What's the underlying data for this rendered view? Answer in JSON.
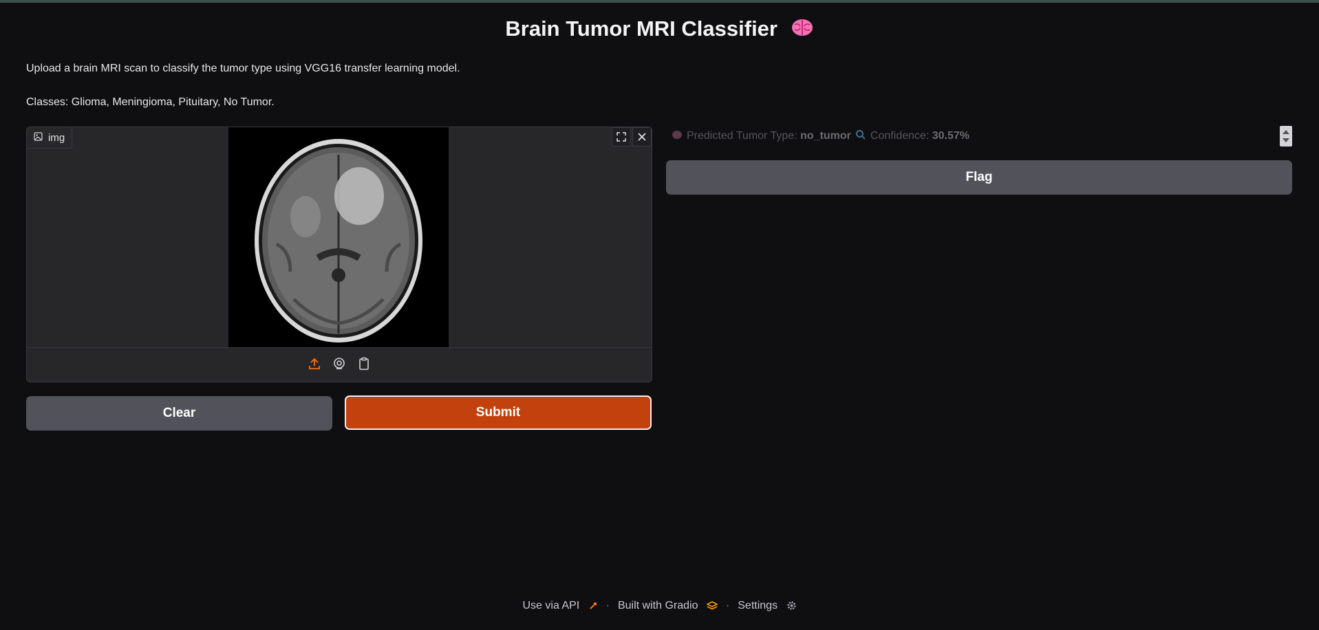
{
  "header": {
    "title": "Brain Tumor MRI Classifier",
    "title_icon": "brain-icon"
  },
  "description": {
    "line1": "Upload a brain MRI scan to classify the tumor type using VGG16 transfer learning model.",
    "line2": "Classes: Glioma, Meningioma, Pituitary, No Tumor."
  },
  "image_input": {
    "label": "img",
    "label_icon": "image-icon",
    "tools": [
      "fullscreen-icon",
      "close-icon"
    ],
    "sources": [
      "upload-icon",
      "webcam-icon",
      "clipboard-icon"
    ]
  },
  "buttons": {
    "clear": "Clear",
    "submit": "Submit",
    "flag": "Flag"
  },
  "output": {
    "predicted_label": "Predicted Tumor Type:",
    "predicted_value": "no_tumor",
    "confidence_label": "Confidence:",
    "confidence_value": "30.57%"
  },
  "footer": {
    "api": "Use via API",
    "built": "Built with Gradio",
    "settings": "Settings",
    "separator": "·"
  },
  "colors": {
    "background": "#0f0f11",
    "panel": "#27272a",
    "secondary_button": "#52525b",
    "primary_button": "#c2410c",
    "accent_orange": "#f97316"
  }
}
